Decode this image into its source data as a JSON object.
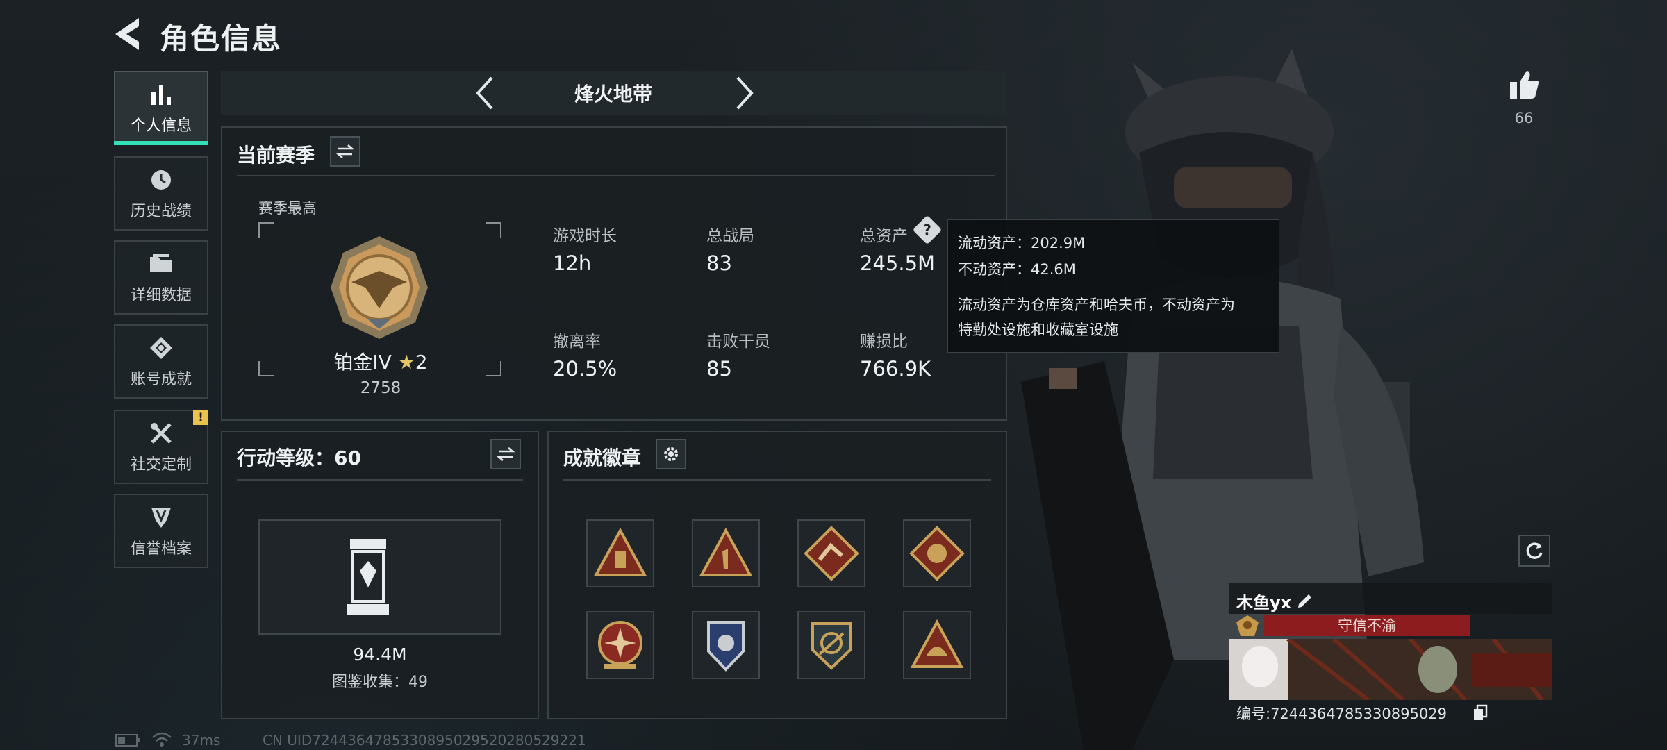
{
  "header": {
    "title": "角色信息"
  },
  "sidebar": {
    "items": [
      {
        "label": "个人信息",
        "icon": "bar-chart-icon",
        "active": true
      },
      {
        "label": "历史战绩",
        "icon": "clock-icon"
      },
      {
        "label": "详细数据",
        "icon": "folder-icon"
      },
      {
        "label": "账号成就",
        "icon": "achievement-icon"
      },
      {
        "label": "社交定制",
        "icon": "tools-icon",
        "badge": "!"
      },
      {
        "label": "信誉档案",
        "icon": "shield-icon"
      }
    ]
  },
  "mode": {
    "title": "烽火地带"
  },
  "season": {
    "title": "当前赛季",
    "highest_label": "赛季最高",
    "rank_name": "铂金IV",
    "rank_stars": "2",
    "rank_score": "2758",
    "stats": [
      {
        "label": "游戏时长",
        "value": "12h"
      },
      {
        "label": "总战局",
        "value": "83"
      },
      {
        "label": "总资产",
        "value": "245.5M"
      },
      {
        "label": "撤离率",
        "value": "20.5%"
      },
      {
        "label": "击败干员",
        "value": "85"
      },
      {
        "label": "赚损比",
        "value": "766.9K"
      }
    ]
  },
  "tooltip": {
    "liquid": "流动资产：202.9M",
    "fixed": "不动资产：42.6M",
    "desc_1": "流动资产为仓库资产和哈夫币，不动资产为",
    "desc_2": "特勤处设施和收藏室设施"
  },
  "action": {
    "title": "行动等级：60",
    "value": "94.4M",
    "collection": "图鉴收集：49"
  },
  "badges": {
    "title": "成就徽章",
    "items": [
      "badge-1",
      "badge-2",
      "badge-3",
      "badge-4",
      "badge-5",
      "badge-6",
      "badge-7",
      "badge-8"
    ]
  },
  "likes": {
    "count": "66"
  },
  "profile": {
    "name": "木鱼yx",
    "title_tag": "守信不渝",
    "uid_line": "编号:7244364785330895029"
  },
  "footer": {
    "ping": "37ms",
    "uid": "CN UID7244364785330895029520280529221"
  },
  "colors": {
    "accent": "#33e0b8",
    "warning": "#e9c34b",
    "tag_red": "#8d1c1f"
  }
}
